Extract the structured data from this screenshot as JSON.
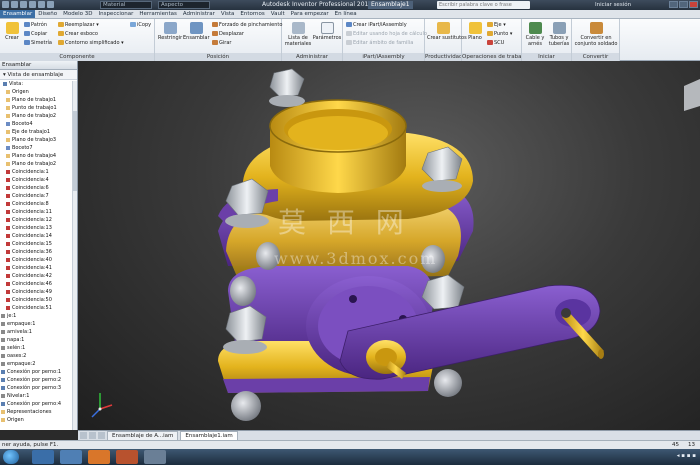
{
  "titlebar": {
    "material": "Material",
    "appearance": "Aspecto",
    "title": "Autodesk Inventor Professional 2012",
    "document": "Ensamblaje1",
    "search_placeholder": "Escribir palabra clave o frase",
    "signin": "Iniciar sesión"
  },
  "tabs": [
    "Ensamblar",
    "Diseño",
    "Modelo 3D",
    "Inspeccionar",
    "Herramientas",
    "Administrar",
    "Vista",
    "Entornos",
    "Vault",
    "Para empezar",
    "En línea"
  ],
  "ribbon": {
    "componente": {
      "label": "Componente",
      "crear": "Crear",
      "patron": "Patrón",
      "copiar": "Copiar",
      "simetria": "Simetría",
      "reemplazar": "Reemplazar",
      "crear_esboco": "Crear esboco",
      "contorno": "Contorno simplificado",
      "icopy": "iCopy"
    },
    "posicion": {
      "label": "Posición",
      "restringir": "Restringir",
      "ensamblar": "Ensamblar",
      "forzado": "Forzado de pinchamiento",
      "desplazar": "Desplazar",
      "girar": "Girar"
    },
    "administrar": {
      "label": "Administrar",
      "lista": "Lista de materiales",
      "parametros": "Parámetros"
    },
    "ipart": {
      "label": "iPart/iAssembly",
      "crear": "Crear iPart/iAssembly",
      "editar": "Editar usando hoja de cálculo",
      "editar_fam": "Editar ámbito de familia"
    },
    "productividad": {
      "label": "Productividad",
      "crear": "Crear sustitutos"
    },
    "operaciones": {
      "label": "Operaciones de trabajo",
      "plano": "Plano",
      "eje": "Eje",
      "punto": "Punto",
      "scu": "SCU"
    },
    "iniciar": {
      "label": "Iniciar",
      "cable": "Cable y arnés",
      "tubos": "Tubos y tuberías"
    },
    "convertir": {
      "label": "Convertir",
      "convertir": "Convertir en conjunto soldado"
    }
  },
  "browser": {
    "header": "Ensamblar",
    "subheader": "Vista de ensamblaje",
    "items": [
      {
        "label": "Vista:",
        "color": "#5b7fb1"
      },
      {
        "label": "Origen",
        "color": "#e8c070"
      },
      {
        "label": "Plano de trabajo1",
        "color": "#e8c070"
      },
      {
        "label": "Punto de trabajo1",
        "color": "#e8c070"
      },
      {
        "label": "Plano de trabajo2",
        "color": "#e8c070"
      },
      {
        "label": "Boceto4",
        "color": "#6c8cc4"
      },
      {
        "label": "Eje de trabajo1",
        "color": "#e8c070"
      },
      {
        "label": "Plano de trabajo3",
        "color": "#e8c070"
      },
      {
        "label": "Boceto7",
        "color": "#6c8cc4"
      },
      {
        "label": "Plano de trabajo4",
        "color": "#e8c070"
      },
      {
        "label": "Plano de trabajo2",
        "color": "#e8c070"
      },
      {
        "label": "Coincidencia:1",
        "color": "#c23a3a"
      },
      {
        "label": "Coincidencia:4",
        "color": "#c23a3a"
      },
      {
        "label": "Coincidencia:6",
        "color": "#c23a3a"
      },
      {
        "label": "Coincidencia:7",
        "color": "#c23a3a"
      },
      {
        "label": "Coincidencia:8",
        "color": "#c23a3a"
      },
      {
        "label": "Coincidencia:11",
        "color": "#c23a3a"
      },
      {
        "label": "Coincidencia:12",
        "color": "#c23a3a"
      },
      {
        "label": "Coincidencia:13",
        "color": "#c23a3a"
      },
      {
        "label": "Coincidencia:14",
        "color": "#c23a3a"
      },
      {
        "label": "Coincidencia:15",
        "color": "#c23a3a"
      },
      {
        "label": "Coincidencia:36",
        "color": "#c23a3a"
      },
      {
        "label": "Coincidencia:40",
        "color": "#c23a3a"
      },
      {
        "label": "Coincidencia:41",
        "color": "#c23a3a"
      },
      {
        "label": "Coincidencia:42",
        "color": "#c23a3a"
      },
      {
        "label": "Coincidencia:46",
        "color": "#c23a3a"
      },
      {
        "label": "Coincidencia:49",
        "color": "#c23a3a"
      },
      {
        "label": "Coincidencia:50",
        "color": "#c23a3a"
      },
      {
        "label": "Coincidencia:51",
        "color": "#c23a3a"
      },
      {
        "label": "je:1",
        "color": "#8a8a8a"
      },
      {
        "label": "empaque:1",
        "color": "#8a8a8a"
      },
      {
        "label": "arnivela:1",
        "color": "#8a8a8a"
      },
      {
        "label": "napa:1",
        "color": "#8a8a8a"
      },
      {
        "label": "selén:1",
        "color": "#8a8a8a"
      },
      {
        "label": "oases:2",
        "color": "#8a8a8a"
      },
      {
        "label": "empaque:2",
        "color": "#8a8a8a"
      },
      {
        "label": "Conexión por perno:1",
        "color": "#5b7fb1"
      },
      {
        "label": "Conexión por perno:2",
        "color": "#5b7fb1"
      },
      {
        "label": "Conexión por perno:3",
        "color": "#5b7fb1"
      },
      {
        "label": "Nivelar:1",
        "color": "#8a8a8a"
      },
      {
        "label": "Conexión por perno:4",
        "color": "#5b7fb1"
      },
      {
        "label": "Representaciones",
        "color": "#e8c070"
      },
      {
        "label": "Origen",
        "color": "#e8c070"
      }
    ]
  },
  "watermark": {
    "chinese": "莫 西 网",
    "url": "www.3dmox.com"
  },
  "doctabs": [
    "Ensamblaje de A...iam",
    "Ensamblaje1.iam"
  ],
  "status": {
    "text": "ner ayuda, pulse F1.",
    "right1": "45",
    "right2": "13"
  },
  "colors": {
    "gold": "#e3b31d",
    "purple": "#6b3fa8",
    "bolt": "#cfd3d8"
  }
}
